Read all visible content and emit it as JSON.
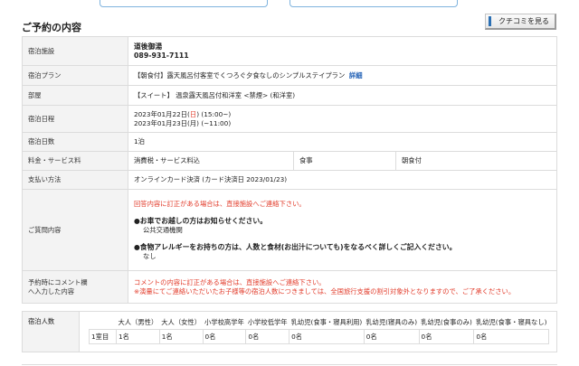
{
  "header": {
    "title": "ご予約の内容"
  },
  "review_button": {
    "label": "クチコミを見る"
  },
  "details": {
    "facility": {
      "label": "宿泊施設",
      "name": "道後御湯",
      "phone": "089-931-7111"
    },
    "plan": {
      "label": "宿泊プラン",
      "value": "【朝食付】露天風呂付客室でくつろぐ夕食なしのシンプルステイプラン",
      "link": "詳細"
    },
    "room": {
      "label": "部屋",
      "value": "【スイート】 温泉露天風呂付和洋室 <禁煙> (和洋室)"
    },
    "dates": {
      "label": "宿泊日程",
      "checkin_prefix": "2023年01月22日(",
      "checkin_day": "日",
      "checkin_suffix": ") (15:00~)",
      "checkout": "2023年01月23日(月) (~11:00)"
    },
    "nights": {
      "label": "宿泊日数",
      "value": "1泊"
    },
    "fee": {
      "label": "料金・サービス料",
      "value": "消費税・サービス料込",
      "meal_label": "食事",
      "meal_value": "朝食付"
    },
    "payment": {
      "label": "支払い方法",
      "value": "オンラインカード決済 (カード決済日 2023/01/23)"
    },
    "questions": {
      "label": "ご質問内容",
      "note": "回答内容に訂正がある場合は、直接施設へご連絡下さい。",
      "q1": "●お車でお越しの方はお知らせください。",
      "a1": "公共交通機関",
      "q2": "●食物アレルギーをお持ちの方は、人数と食材(お出汁についても)をなるべく詳しくご記入ください。",
      "a2": "なし"
    },
    "comment": {
      "label_line1": "予約時にコメント欄",
      "label_line2": "へ入力した内容",
      "line1": "コメントの内容に訂正がある場合は、直接施設へご連絡下さい。",
      "line2": "※演量にてご連絡いただいたお子様等の宿泊人数につきましては、全国旅行支援の割引対象外となりますので、ご了承ください。"
    }
  },
  "guests": {
    "label": "宿泊人数",
    "headers": [
      "大人（男性）",
      "大人（女性）",
      "小学校高学年",
      "小学校低学年",
      "乳幼児(食事・寝具利用)",
      "乳幼児(寝具のみ)",
      "乳幼児(食事のみ)",
      "乳幼児(食事・寝具なし)"
    ],
    "row_label": "1室目",
    "values": [
      "1名",
      "1名",
      "0名",
      "0名",
      "0名",
      "0名",
      "0名",
      "0名"
    ]
  }
}
